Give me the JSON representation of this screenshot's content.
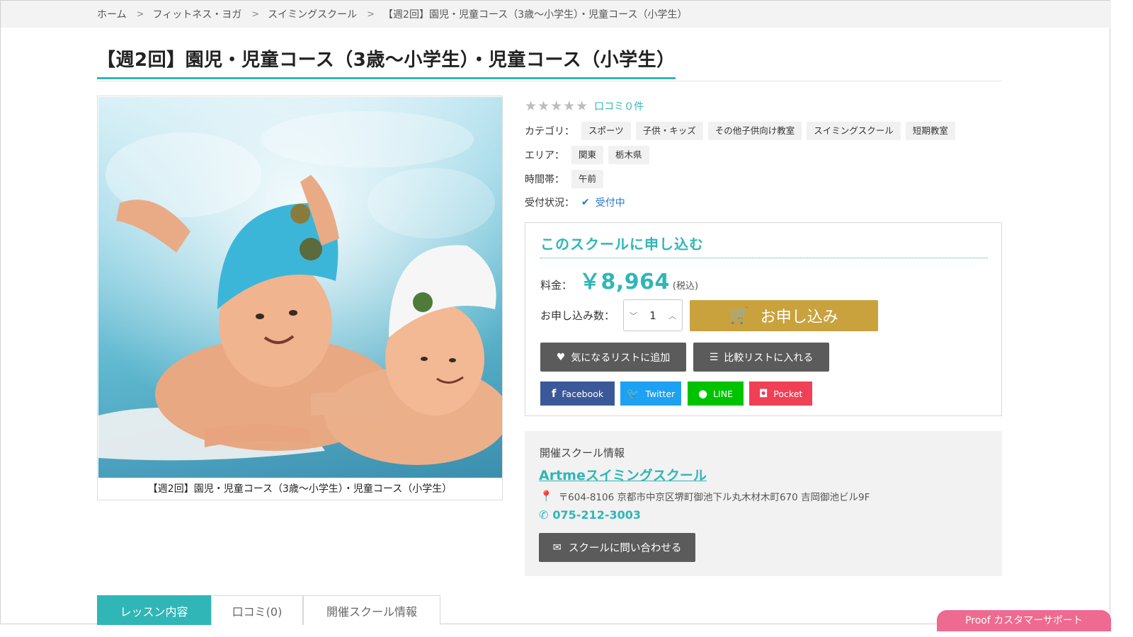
{
  "breadcrumb": {
    "items": [
      "ホーム",
      "フィットネス・ヨガ",
      "スイミングスクール",
      "【週2回】園児・児童コース（3歳〜小学生）・児童コース（小学生）"
    ],
    "sep": ">"
  },
  "page": {
    "title": "【週2回】園児・児童コース（3歳〜小学生）・児童コース（小学生）",
    "image_caption": "【週2回】園児・児童コース（3歳〜小学生）・児童コース（小学生）"
  },
  "rating": {
    "stars": "★★★★★",
    "score": 0,
    "review_link": "口コミ０件"
  },
  "meta": {
    "category_label": "カテゴリ：",
    "categories": [
      "スポーツ",
      "子供・キッズ",
      "その他子供向け教室",
      "スイミングスクール",
      "短期教室"
    ],
    "area_label": "エリア：",
    "areas": [
      "関東",
      "栃木県"
    ],
    "time_label": "時間帯：",
    "times": [
      "午前"
    ],
    "status_label": "受付状況：",
    "status_value": "受付中"
  },
  "buy": {
    "heading": "このスクールに申し込む",
    "price_label": "料金：",
    "price": "￥8,964",
    "tax_note": "(税込)",
    "qty_label": "お申し込み数：",
    "qty_value": "1",
    "apply_label": "お申し込み",
    "wishlist_label": "気になるリストに追加",
    "compare_label": "比較リストに入れる",
    "share": {
      "facebook": "Facebook",
      "twitter": "Twitter",
      "line": "LINE",
      "pocket": "Pocket"
    }
  },
  "school": {
    "heading": "開催スクール情報",
    "name": "Artmeスイミングスクール",
    "address": "〒604-8106 京都市中京区堺町御池下ル丸木材木町670 吉岡御池ビル9F",
    "tel": "075-212-3003",
    "contact_label": "スクールに問い合わせる"
  },
  "tabs": [
    "レッスン内容",
    "口コミ(0)",
    "開催スクール情報"
  ],
  "support_label": "Proof カスタマーサポート",
  "colors": {
    "accent": "#30b6b7",
    "apply": "#c9a23e",
    "dark_button": "#5b5b5b",
    "facebook": "#3b5998",
    "twitter": "#1da1f2",
    "line": "#00c300",
    "pocket": "#ef4056",
    "support": "#ef6a90"
  }
}
